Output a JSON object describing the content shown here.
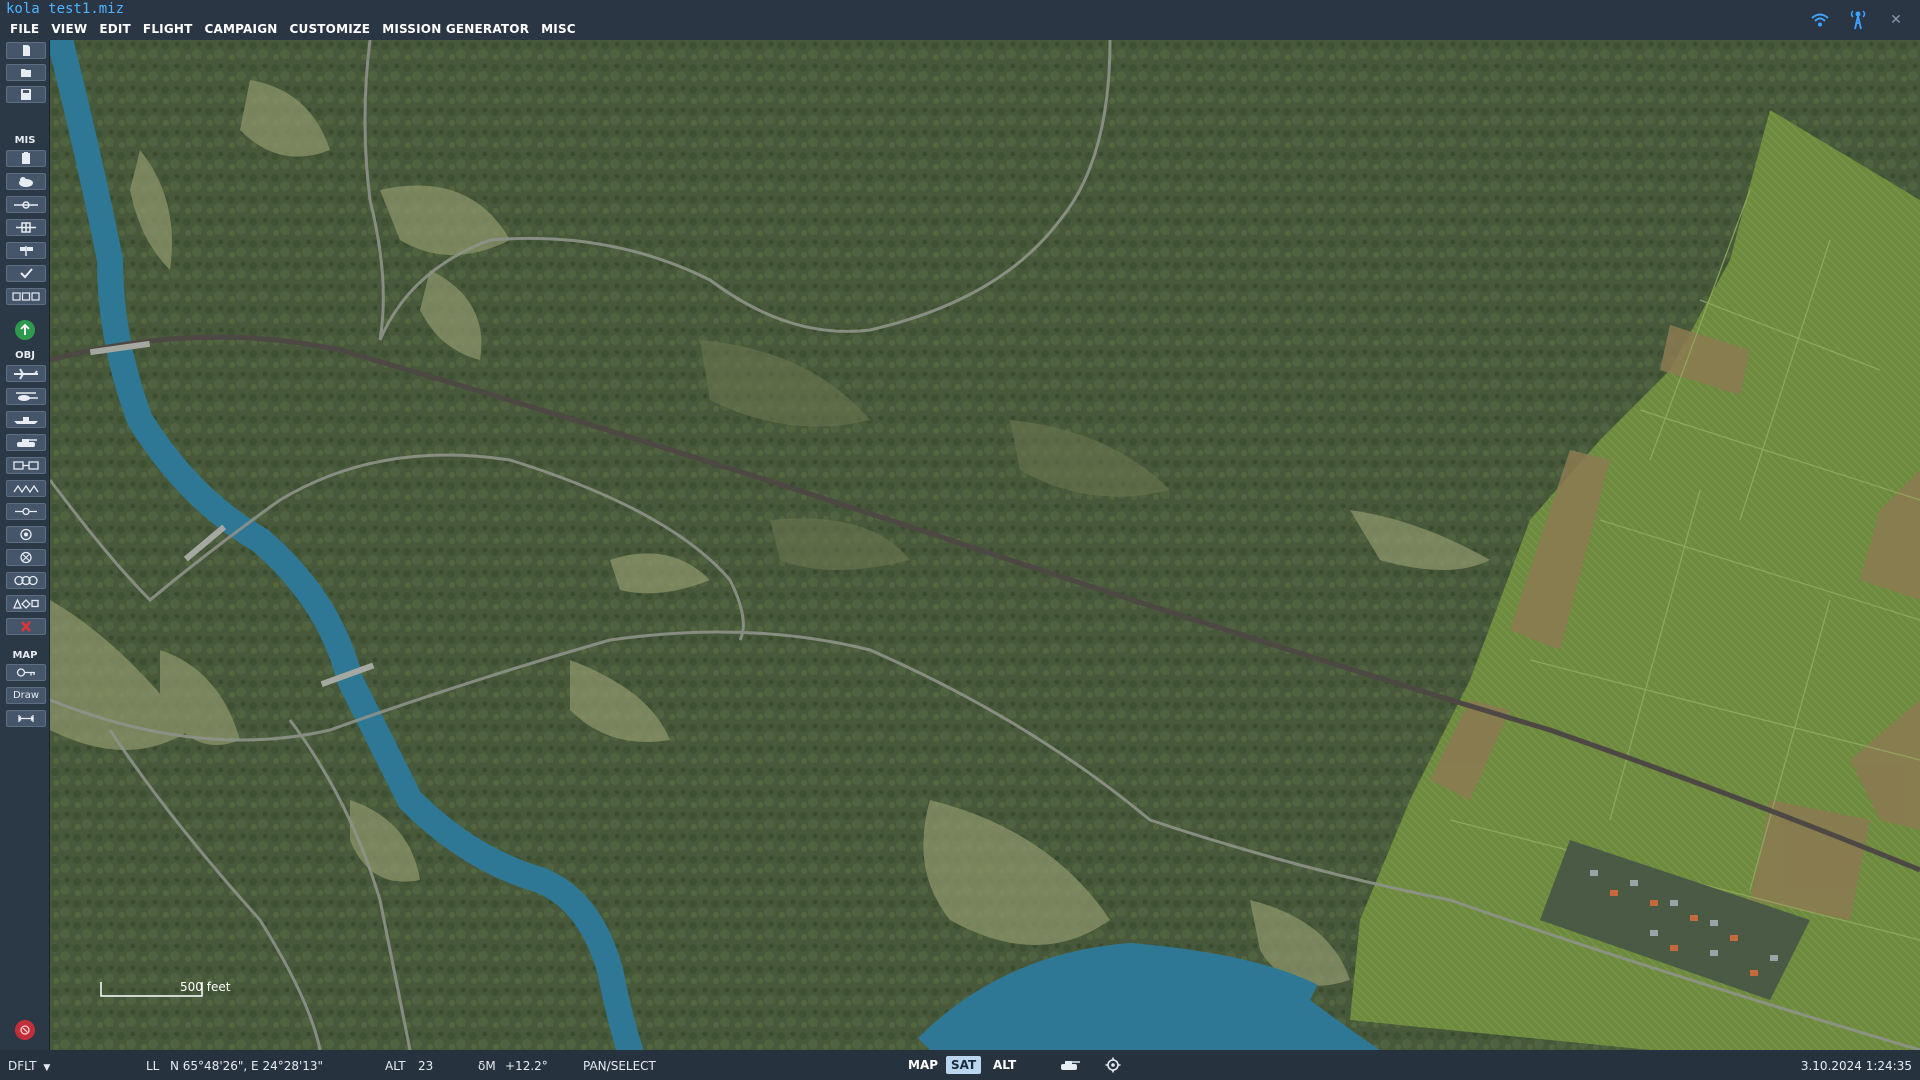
{
  "window": {
    "title": "kola test1.miz"
  },
  "menu": [
    "FILE",
    "VIEW",
    "EDIT",
    "FLIGHT",
    "CAMPAIGN",
    "CUSTOMIZE",
    "MISSION GENERATOR",
    "MISC"
  ],
  "toolbar": {
    "sections": {
      "mis": "MIS",
      "obj": "OBJ",
      "map": "MAP"
    },
    "draw_label": "Draw"
  },
  "map": {
    "scale_label": "500 feet"
  },
  "status": {
    "profile": "DFLT",
    "coord_mode": "LL",
    "coords": "N 65°48'26\", E 24°28'13\"",
    "alt_label": "ALT",
    "alt_value": "23",
    "mag_label": "δM",
    "mag_value": "+12.2°",
    "mode": "PAN/SELECT",
    "map_modes": [
      "MAP",
      "SAT",
      "ALT"
    ],
    "active_map_mode": "SAT",
    "datetime": "3.10.2024 1:24:35"
  },
  "colors": {
    "title": "#4fb4ff",
    "accent_blue": "#3ea2ff",
    "river": "#2f7895",
    "forest": "#46593a",
    "field": "#6f8a3f"
  }
}
